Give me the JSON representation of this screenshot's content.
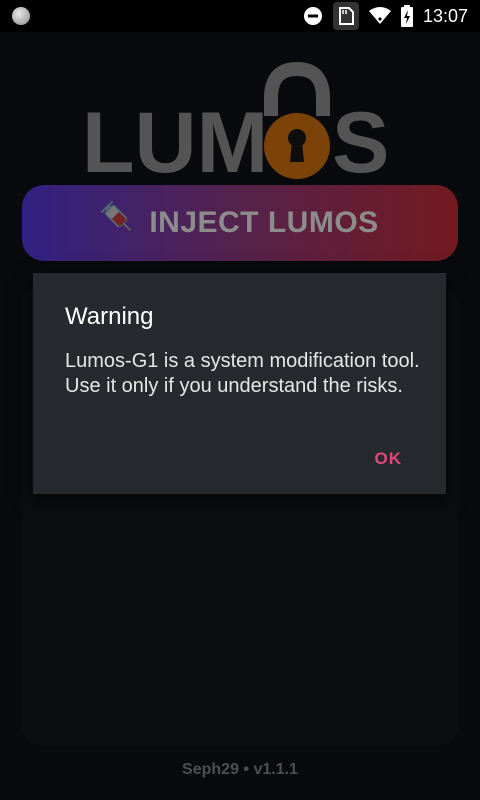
{
  "status_bar": {
    "time": "13:07",
    "icons": [
      "notification-dot-icon",
      "dnd-icon",
      "sd-card-icon",
      "wifi-icon",
      "battery-icon"
    ]
  },
  "app": {
    "logo_text": "LUMOS",
    "inject_button": {
      "label": "INJECT LUMOS",
      "icon": "syringe-icon"
    },
    "footer": "Seph29 • v1.1.1"
  },
  "dialog": {
    "title": "Warning",
    "message": "Lumos-G1 is a system modification tool. Use it only if you understand the risks.",
    "ok_label": "OK"
  },
  "colors": {
    "accent": "#e0487a",
    "lock": "#e07a10",
    "gradient_start": "#5a3df0",
    "gradient_end": "#d1303a"
  }
}
